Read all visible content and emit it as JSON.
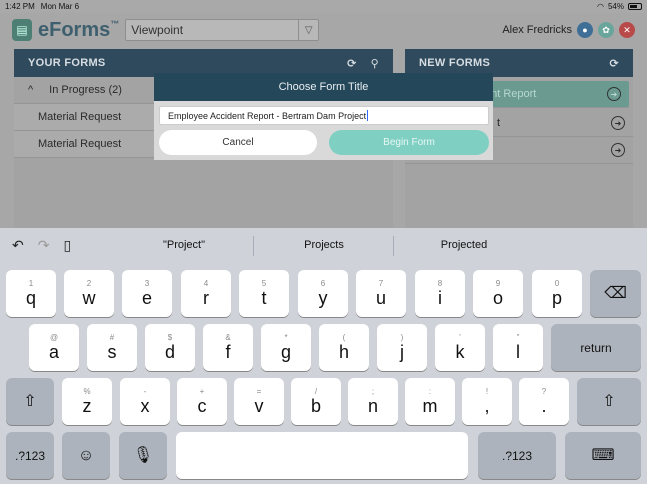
{
  "status_bar": {
    "time": "1:42 PM",
    "date": "Mon Mar 6",
    "battery": "54%"
  },
  "app": {
    "logo_text": "eForms",
    "logo_tm": "™",
    "project": "Viewpoint",
    "user_name": "Alex Fredricks"
  },
  "your_forms": {
    "title": "YOUR FORMS",
    "group_label": "In Progress (2)",
    "items": [
      "Material Request",
      "Material Request"
    ]
  },
  "new_forms": {
    "title": "NEW FORMS",
    "items": [
      "ent Report",
      "t",
      ""
    ]
  },
  "modal": {
    "title": "Choose Form Title",
    "input_value": "Employee Accident Report - Bertram Dam Project",
    "cancel_label": "Cancel",
    "begin_label": "Begin Form"
  },
  "keyboard": {
    "suggestions": [
      "\"Project\"",
      "Projects",
      "Projected"
    ],
    "row1": [
      {
        "hint": "1",
        "key": "q"
      },
      {
        "hint": "2",
        "key": "w"
      },
      {
        "hint": "3",
        "key": "e"
      },
      {
        "hint": "4",
        "key": "r"
      },
      {
        "hint": "5",
        "key": "t"
      },
      {
        "hint": "6",
        "key": "y"
      },
      {
        "hint": "7",
        "key": "u"
      },
      {
        "hint": "8",
        "key": "i"
      },
      {
        "hint": "9",
        "key": "o"
      },
      {
        "hint": "0",
        "key": "p"
      }
    ],
    "row2": [
      {
        "hint": "@",
        "key": "a"
      },
      {
        "hint": "#",
        "key": "s"
      },
      {
        "hint": "$",
        "key": "d"
      },
      {
        "hint": "&",
        "key": "f"
      },
      {
        "hint": "*",
        "key": "g"
      },
      {
        "hint": "(",
        "key": "h"
      },
      {
        "hint": ")",
        "key": "j"
      },
      {
        "hint": "'",
        "key": "k"
      },
      {
        "hint": "\"",
        "key": "l"
      }
    ],
    "row3": [
      {
        "hint": "%",
        "key": "z"
      },
      {
        "hint": "-",
        "key": "x"
      },
      {
        "hint": "+",
        "key": "c"
      },
      {
        "hint": "=",
        "key": "v"
      },
      {
        "hint": "/",
        "key": "b"
      },
      {
        "hint": ";",
        "key": "n"
      },
      {
        "hint": ":",
        "key": "m"
      },
      {
        "hint": "!",
        "key": ","
      },
      {
        "hint": "?",
        "key": "."
      }
    ],
    "return_label": "return",
    "numbers_label": ".?123"
  }
}
